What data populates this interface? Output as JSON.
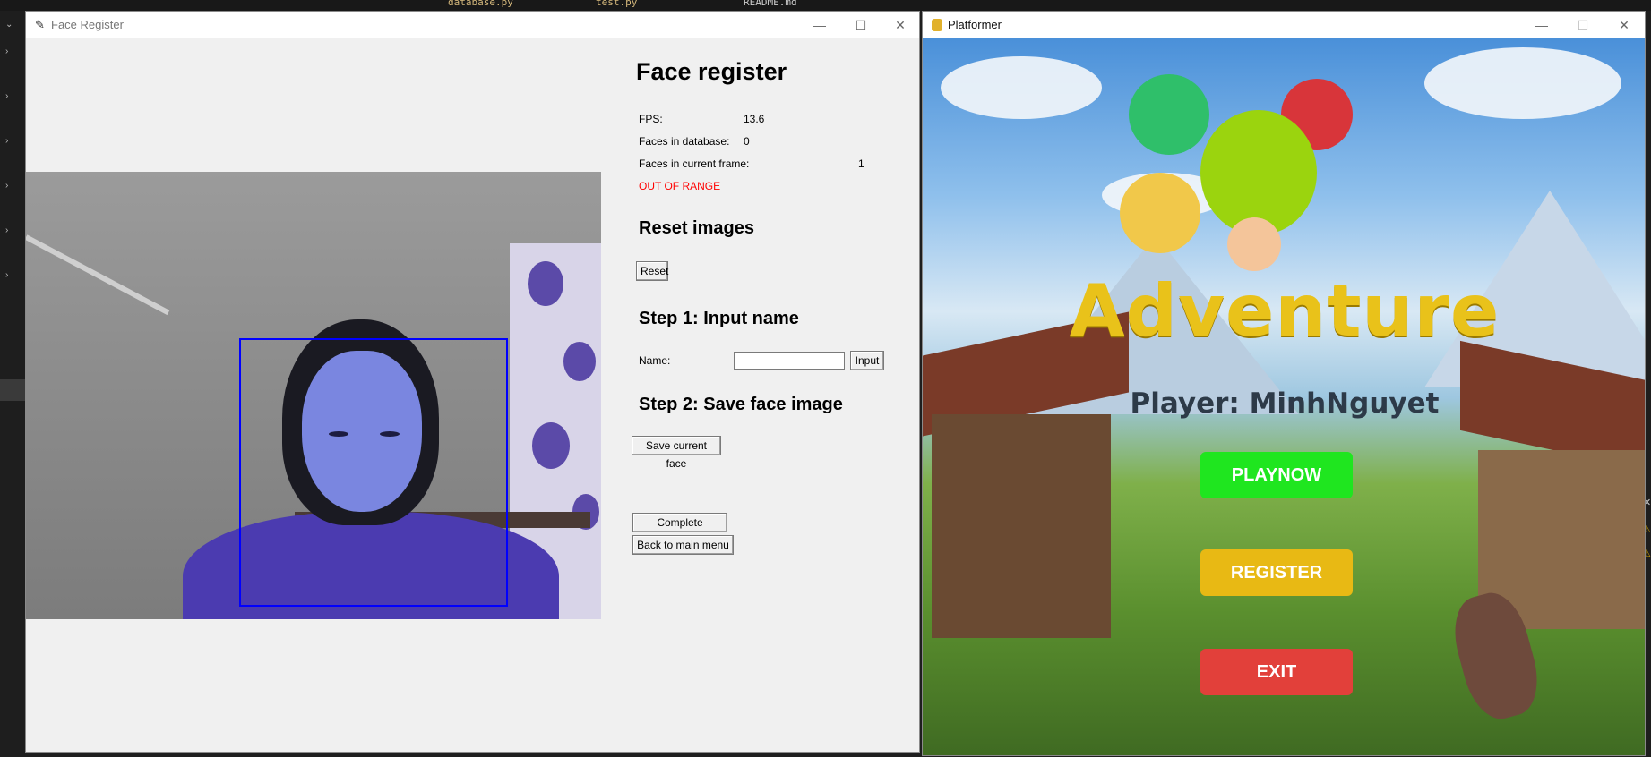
{
  "background": {
    "tabs": [
      "database.py",
      "test.py",
      "README.md"
    ]
  },
  "face_window": {
    "title": "Face Register",
    "controls": {
      "minimize": "—",
      "maximize": "☐",
      "close": "✕"
    },
    "heading": "Face register",
    "fps_label": "FPS:",
    "fps_value": "13.6",
    "faces_db_label": "Faces in database:",
    "faces_db_value": "0",
    "faces_frame_label": "Faces in current frame:",
    "faces_frame_value": "1",
    "status": "OUT OF RANGE",
    "reset_heading": "Reset images",
    "reset_button": "Reset",
    "step1_heading": "Step 1: Input name",
    "name_label": "Name:",
    "name_value": "",
    "input_button": "Input",
    "step2_heading": "Step 2: Save face image",
    "save_button": "Save current face",
    "complete_button": "Complete Register",
    "back_button": "Back to main menu"
  },
  "platformer_window": {
    "title": "Platformer",
    "controls": {
      "minimize": "—",
      "maximize": "☐",
      "close": "✕"
    },
    "game_title": "Adventure",
    "player_text": "Player: MinhNguyet",
    "buttons": {
      "play": {
        "label": "PLAYNOW",
        "color": "#1fe61f"
      },
      "register": {
        "label": "REGISTER",
        "color": "#e8b914"
      },
      "exit": {
        "label": "EXIT",
        "color": "#e2403a"
      }
    }
  }
}
